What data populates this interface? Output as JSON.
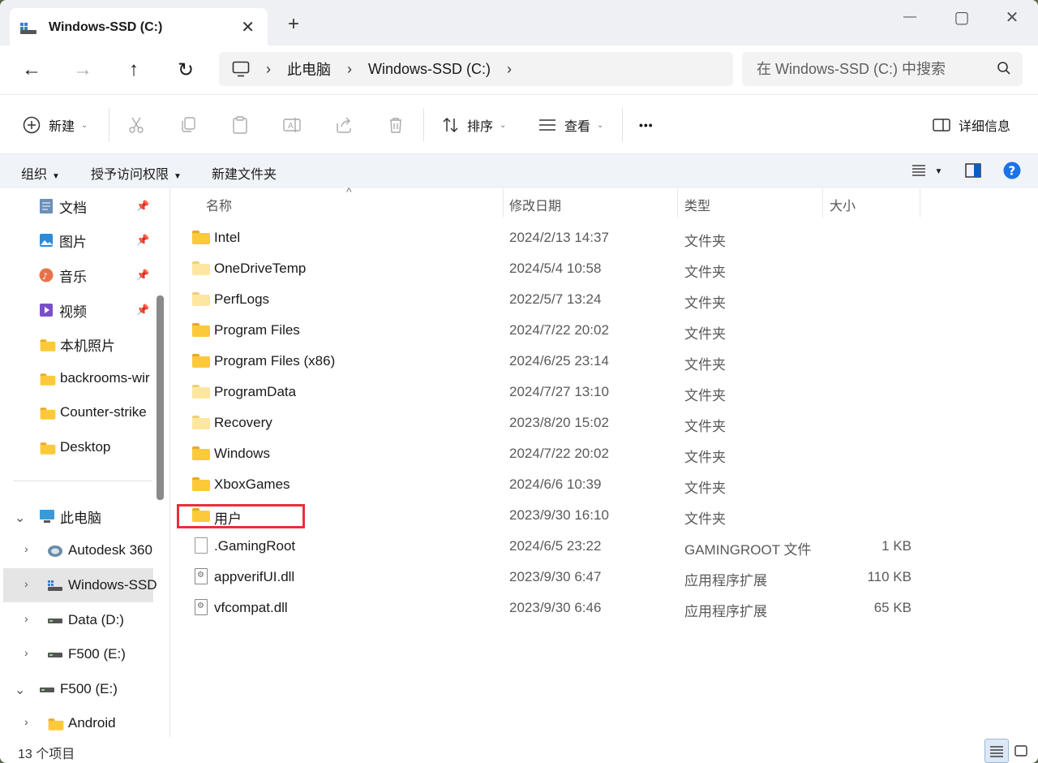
{
  "window": {
    "tab_title": "Windows-SSD (C:)",
    "tab_close": "✕",
    "new_tab": "+",
    "minimize": "—",
    "maximize": "▢",
    "close": "✕"
  },
  "nav": {
    "back": "←",
    "forward": "→",
    "up": "↑",
    "refresh": "↻",
    "breadcrumbs": [
      "此电脑",
      "Windows-SSD (C:)"
    ],
    "crumb_sep": "›",
    "search_placeholder": "在 Windows-SSD (C:) 中搜索"
  },
  "toolbar": {
    "new_label": "新建",
    "sort_label": "排序",
    "view_label": "查看",
    "more_label": "•••",
    "details_label": "详细信息"
  },
  "subbar": {
    "organize": "组织",
    "grant_access": "授予访问权限",
    "new_folder": "新建文件夹"
  },
  "sidebar": {
    "quick": [
      {
        "label": "文档",
        "icon": "documents-icon",
        "pinned": true
      },
      {
        "label": "图片",
        "icon": "pictures-icon",
        "pinned": true
      },
      {
        "label": "音乐",
        "icon": "music-icon",
        "pinned": true
      },
      {
        "label": "视频",
        "icon": "videos-icon",
        "pinned": true
      },
      {
        "label": "本机照片",
        "icon": "folder-icon",
        "pinned": false
      },
      {
        "label": "backrooms-wir",
        "icon": "folder-icon",
        "pinned": false
      },
      {
        "label": "Counter-strike",
        "icon": "folder-icon",
        "pinned": false
      },
      {
        "label": "Desktop",
        "icon": "folder-icon",
        "pinned": false
      }
    ],
    "pin_glyph": "📌",
    "tree": [
      {
        "label": "此电脑",
        "expanded": true
      },
      {
        "label": "Autodesk 360",
        "expanded": false
      },
      {
        "label": "Windows-SSD",
        "expanded": false,
        "selected": true
      },
      {
        "label": "Data (D:)",
        "expanded": false
      },
      {
        "label": "F500 (E:)",
        "expanded": false
      },
      {
        "label": "F500 (E:)",
        "expanded": true
      },
      {
        "label": "Android",
        "expanded": false
      }
    ]
  },
  "columns": {
    "name": "名称",
    "modified": "修改日期",
    "type": "类型",
    "size": "大小",
    "sort_arrow": "^"
  },
  "files": [
    {
      "name": "Intel",
      "date": "2024/2/13 14:37",
      "type": "文件夹",
      "size": "",
      "kind": "folder"
    },
    {
      "name": "OneDriveTemp",
      "date": "2024/5/4 10:58",
      "type": "文件夹",
      "size": "",
      "kind": "folder-pale"
    },
    {
      "name": "PerfLogs",
      "date": "2022/5/7 13:24",
      "type": "文件夹",
      "size": "",
      "kind": "folder-pale"
    },
    {
      "name": "Program Files",
      "date": "2024/7/22 20:02",
      "type": "文件夹",
      "size": "",
      "kind": "folder"
    },
    {
      "name": "Program Files (x86)",
      "date": "2024/6/25 23:14",
      "type": "文件夹",
      "size": "",
      "kind": "folder"
    },
    {
      "name": "ProgramData",
      "date": "2024/7/27 13:10",
      "type": "文件夹",
      "size": "",
      "kind": "folder-pale"
    },
    {
      "name": "Recovery",
      "date": "2023/8/20 15:02",
      "type": "文件夹",
      "size": "",
      "kind": "folder-pale"
    },
    {
      "name": "Windows",
      "date": "2024/7/22 20:02",
      "type": "文件夹",
      "size": "",
      "kind": "folder"
    },
    {
      "name": "XboxGames",
      "date": "2024/6/6 10:39",
      "type": "文件夹",
      "size": "",
      "kind": "folder"
    },
    {
      "name": "用户",
      "date": "2023/9/30 16:10",
      "type": "文件夹",
      "size": "",
      "kind": "folder"
    },
    {
      "name": ".GamingRoot",
      "date": "2024/6/5 23:22",
      "type": "GAMINGROOT 文件",
      "size": "1 KB",
      "kind": "file"
    },
    {
      "name": "appverifUI.dll",
      "date": "2023/9/30 6:47",
      "type": "应用程序扩展",
      "size": "110 KB",
      "kind": "dll"
    },
    {
      "name": "vfcompat.dll",
      "date": "2023/9/30 6:46",
      "type": "应用程序扩展",
      "size": "65 KB",
      "kind": "dll"
    }
  ],
  "status": {
    "item_count": "13 个项目"
  },
  "colors": {
    "accent": "#0067c0",
    "highlight_box": "#e8303a",
    "folder": "#fcc93a"
  }
}
